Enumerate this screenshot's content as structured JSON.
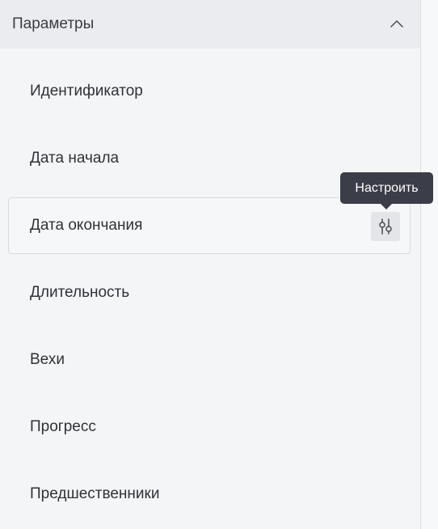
{
  "section": {
    "title": "Параметры",
    "expanded": true
  },
  "items": [
    {
      "label": "Идентификатор"
    },
    {
      "label": "Дата начала"
    },
    {
      "label": "Дата окончания",
      "hovered": true
    },
    {
      "label": "Длительность"
    },
    {
      "label": "Вехи"
    },
    {
      "label": "Прогресс"
    },
    {
      "label": "Предшественники"
    }
  ],
  "tooltip": {
    "text": "Настроить"
  },
  "icons": {
    "collapse": "chevron-up-icon",
    "configure": "sliders-icon"
  },
  "colors": {
    "panel_bg": "#f4f5f7",
    "header_bg": "#ebecef",
    "tooltip_bg": "#3b3e48",
    "text": "#2f3237"
  }
}
